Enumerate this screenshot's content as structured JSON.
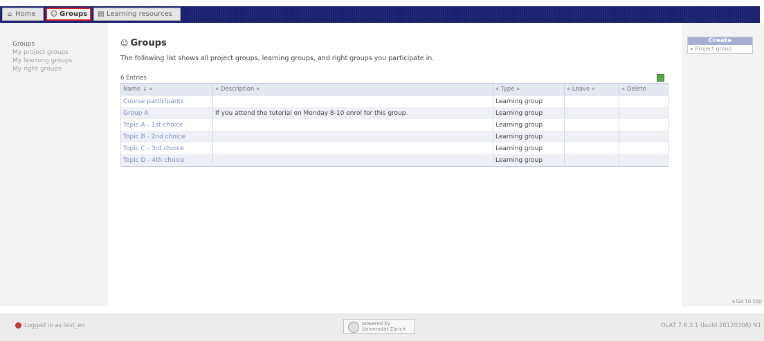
{
  "tabs": [
    {
      "label": "Home",
      "icon": "home-icon"
    },
    {
      "label": "Groups",
      "icon": "groups-icon"
    },
    {
      "label": "Learning resources",
      "icon": "learning-resources-icon"
    }
  ],
  "sidebar": {
    "items": [
      {
        "label": "Groups"
      },
      {
        "label": "My project groups"
      },
      {
        "label": "My learning groups"
      },
      {
        "label": "My right groups"
      }
    ]
  },
  "main": {
    "title": "Groups",
    "description": "The following list shows all project groups, learning groups, and right groups you participate in.",
    "entries": "6 Entries",
    "columns": [
      "Name ↓ »",
      "« Description »",
      "« Type »",
      "« Leave »",
      "« Delete"
    ],
    "rows": [
      {
        "name": "Course participants",
        "description": "",
        "type": "Learning group"
      },
      {
        "name": "Group A",
        "description": "If you attend the tutorial on Monday 8-10 enrol for this group.",
        "type": "Learning group"
      },
      {
        "name": "Topic A - 1st choice",
        "description": "",
        "type": "Learning group"
      },
      {
        "name": "Topic B - 2nd choice",
        "description": "",
        "type": "Learning group"
      },
      {
        "name": "Topic C - 3rd choice",
        "description": "",
        "type": "Learning group"
      },
      {
        "name": "Topic D - 4th choice",
        "description": "",
        "type": "Learning group"
      }
    ]
  },
  "rightcol": {
    "create_title": "Create",
    "create_link": "▸ Project group",
    "go_to_top": "◂ Go to top"
  },
  "footer": {
    "logged": "Logged in as test_en",
    "powered": "powered by\nUniversität Zürich",
    "version": "OLAT 7.6.3.1 (build 20120308) N1"
  },
  "colors": {
    "topbar": "#1a1f6e",
    "highlight": "#d0202a",
    "link": "#7a8cc0",
    "create_header": "#a7aed0"
  }
}
